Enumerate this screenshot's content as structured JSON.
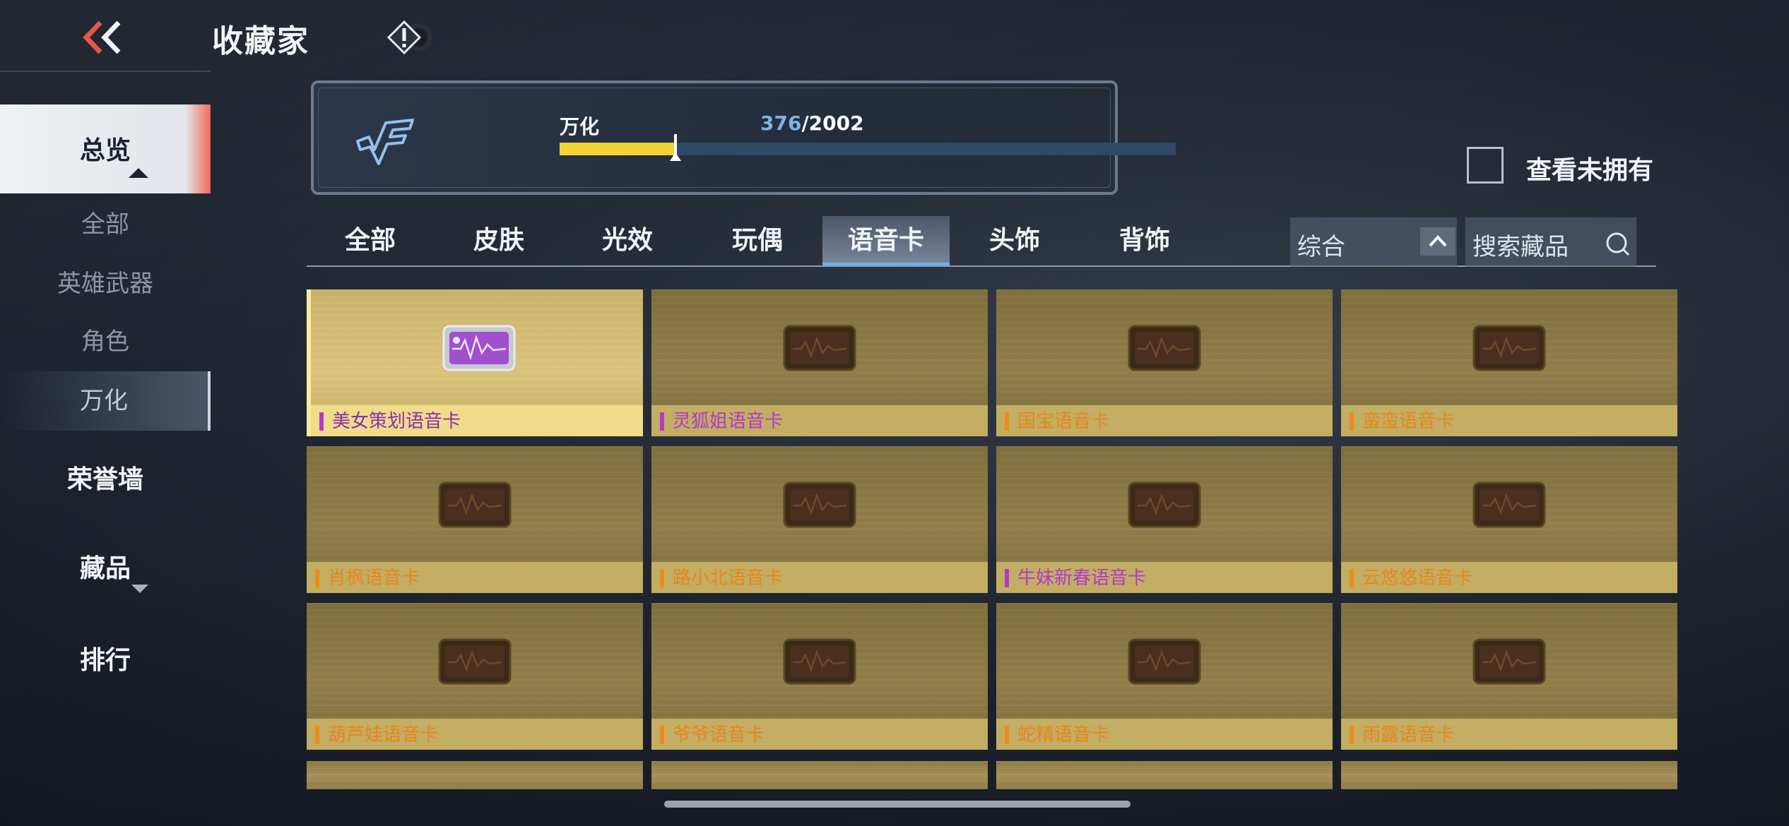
{
  "header": {
    "title": "收藏家",
    "info_icon": "exclamation-diamond-icon",
    "back_icon": "double-chevron-left-icon"
  },
  "sidebar": {
    "overview": "总览",
    "sub_items": [
      "全部",
      "英雄武器",
      "角色",
      "万化"
    ],
    "active_sub": "万化",
    "main_items": [
      "荣誉墙",
      "藏品",
      "排行"
    ]
  },
  "progress": {
    "label": "万化",
    "current": "376",
    "total": "/2002",
    "fraction": 0.188
  },
  "filter": {
    "owned_label": "查看未拥有",
    "owned_checked": false
  },
  "tabs": [
    "全部",
    "皮肤",
    "光效",
    "玩偶",
    "语音卡",
    "头饰",
    "背饰"
  ],
  "active_tab": "语音卡",
  "sort": {
    "label": "综合"
  },
  "search": {
    "placeholder": "搜索藏品"
  },
  "items": [
    {
      "name": "美女策划语音卡",
      "tier_color": "#b23ac8",
      "name_color": "#8a2fb0",
      "owned": true
    },
    {
      "name": "灵狐姐语音卡",
      "tier_color": "#b23ac8",
      "name_color": "#b23ac8",
      "owned": false
    },
    {
      "name": "国宝语音卡",
      "tier_color": "#f08a1c",
      "name_color": "#e9861c",
      "owned": false
    },
    {
      "name": "蛮蛮语音卡",
      "tier_color": "#f08a1c",
      "name_color": "#e9861c",
      "owned": false
    },
    {
      "name": "肖枫语音卡",
      "tier_color": "#f08a1c",
      "name_color": "#e9861c",
      "owned": false
    },
    {
      "name": "路小北语音卡",
      "tier_color": "#f08a1c",
      "name_color": "#e9861c",
      "owned": false
    },
    {
      "name": "牛妹新春语音卡",
      "tier_color": "#b23ac8",
      "name_color": "#b23ac8",
      "owned": false
    },
    {
      "name": "云悠悠语音卡",
      "tier_color": "#f08a1c",
      "name_color": "#e9861c",
      "owned": false
    },
    {
      "name": "葫芦娃语音卡",
      "tier_color": "#f08a1c",
      "name_color": "#e9861c",
      "owned": false
    },
    {
      "name": "爷爷语音卡",
      "tier_color": "#f08a1c",
      "name_color": "#e9861c",
      "owned": false
    },
    {
      "name": "蛇精语音卡",
      "tier_color": "#f08a1c",
      "name_color": "#e9861c",
      "owned": false
    },
    {
      "name": "雨露语音卡",
      "tier_color": "#f08a1c",
      "name_color": "#e9861c",
      "owned": false
    }
  ]
}
